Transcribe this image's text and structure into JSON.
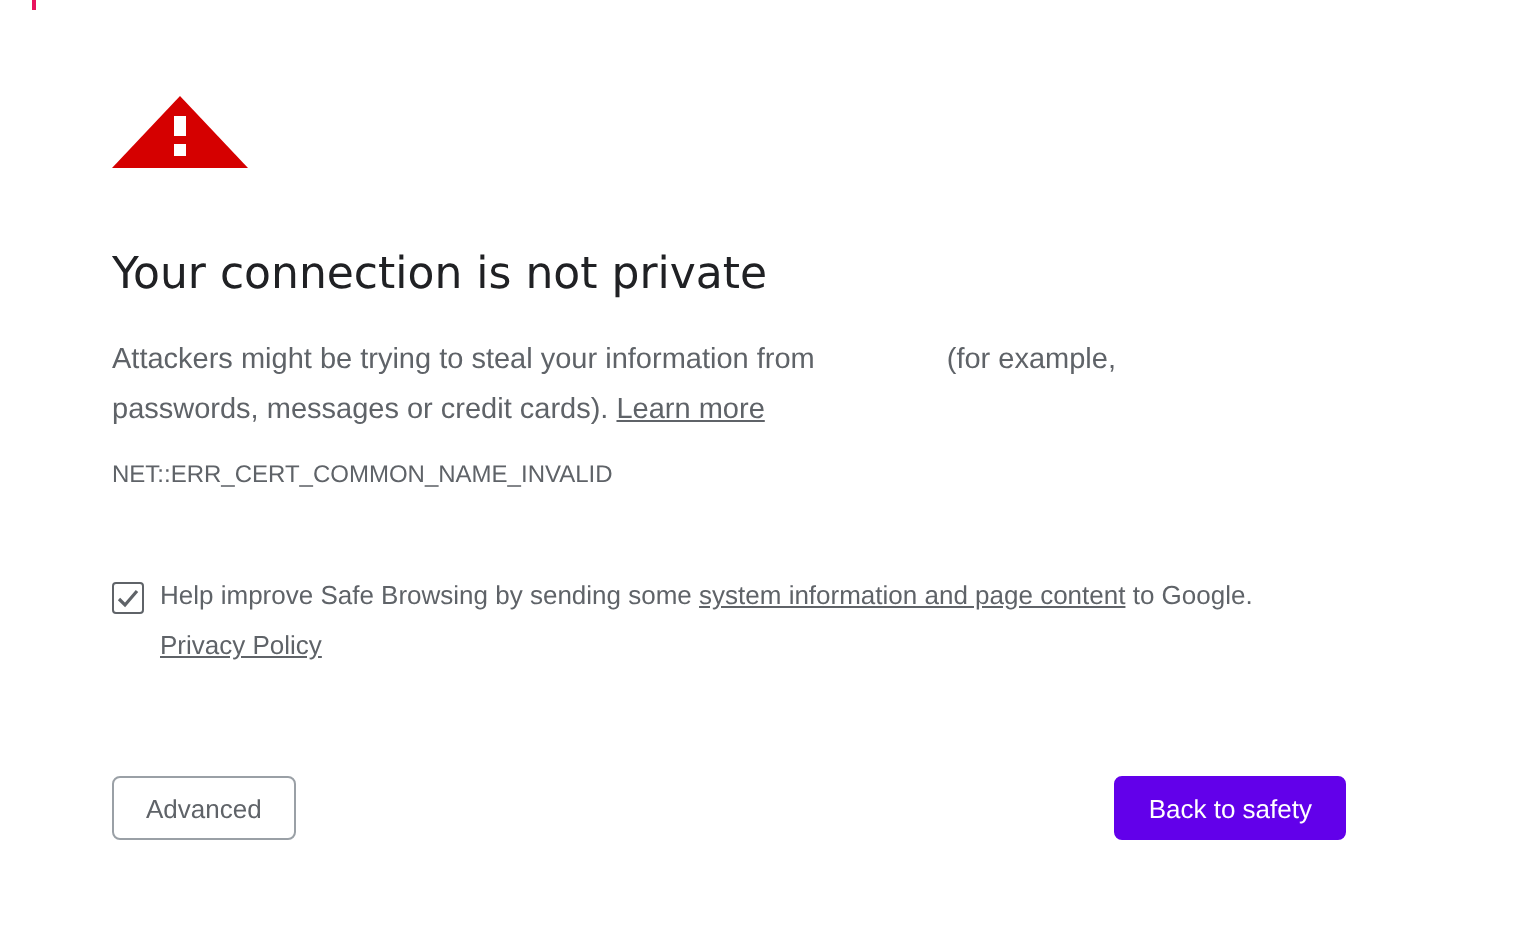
{
  "title": "Your connection is not private",
  "description": {
    "before": "Attackers might be trying to steal your information from",
    "after": "(for example, passwords, messages or credit cards).",
    "link": "Learn more"
  },
  "error_code": "NET::ERR_CERT_COMMON_NAME_INVALID",
  "safe_browsing": {
    "checked": true,
    "text_before": "Help improve Safe Browsing by sending some",
    "link": "system information and page content",
    "text_after": "to Google.",
    "policy_link": "Privacy Policy"
  },
  "buttons": [
    {
      "label": "Advanced",
      "kind": "secondary"
    },
    {
      "label": "Back to safety",
      "kind": "primary"
    }
  ]
}
